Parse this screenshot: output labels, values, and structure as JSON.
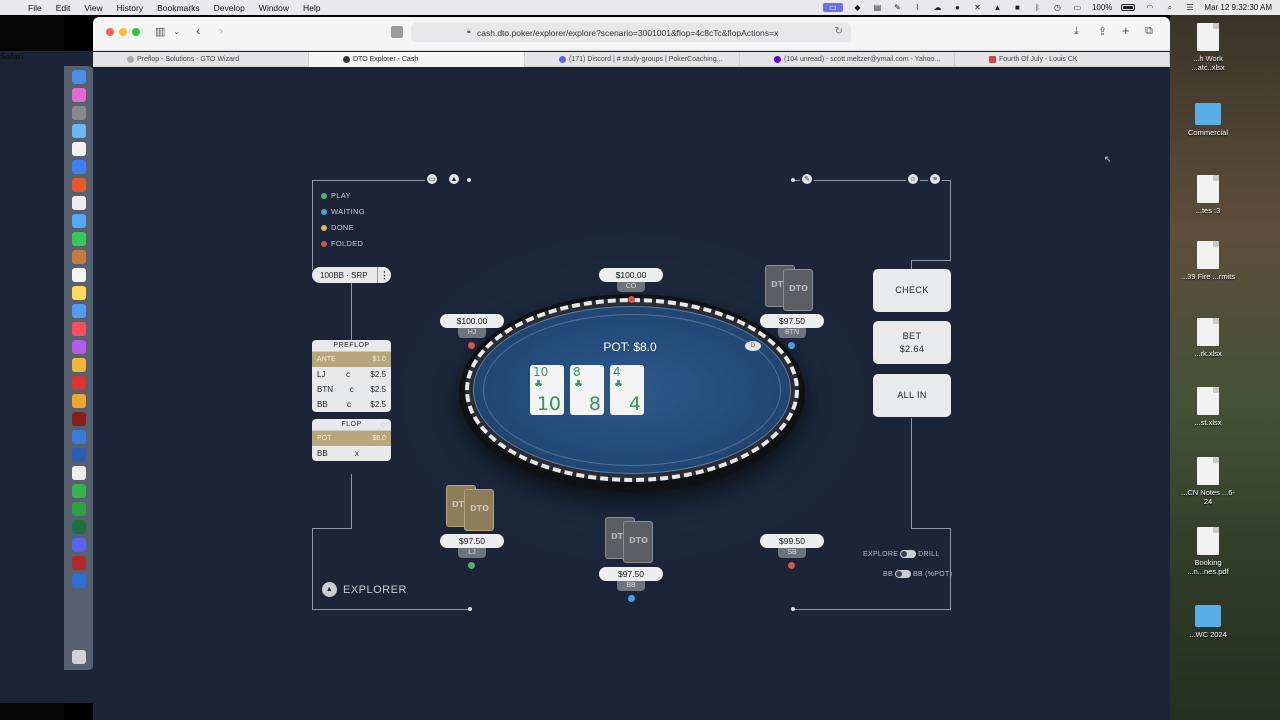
{
  "menubar": {
    "app": "Safari",
    "items": [
      "File",
      "Edit",
      "View",
      "History",
      "Bookmarks",
      "Develop",
      "Window",
      "Help"
    ],
    "battery": "100%",
    "datetime": "Mar 12  9:32:30 AM"
  },
  "browser": {
    "url": "cash.dto.poker/explorer/explore?scenario=3001001&flop=4c8cTc&flopActions=x",
    "tabs": [
      {
        "title": "Preflop - Solutions - GTO Wizard",
        "active": false
      },
      {
        "title": "DTO Explorer - Cash",
        "active": true
      },
      {
        "title": "(171) Discord | # study-groups | PokerCoaching...",
        "active": false
      },
      {
        "title": "(104 unread) - scott.meltzer@ymail.com - Yahoo...",
        "active": false
      },
      {
        "title": "Fourth Of July - Louis CK",
        "active": false
      }
    ]
  },
  "desktop": {
    "items": [
      "...h Work\n...atc..xlsx",
      "Commercial",
      "...tes :3",
      "...39 Fire\n...rmits",
      "...rk.xlsx",
      "...st.xlsx",
      "...CN Notes\n...6-24",
      "Booking\n...n...nes.pdf",
      "...WC 2024"
    ]
  },
  "legend": {
    "items": [
      {
        "label": "PLAY",
        "color": "#4fb06a"
      },
      {
        "label": "WAITING",
        "color": "#4aa3d8"
      },
      {
        "label": "DONE",
        "color": "#e0b94a"
      },
      {
        "label": "FOLDED",
        "color": "#d9534f"
      }
    ]
  },
  "stack_selector": {
    "label": "100BB · SRP",
    "more": "⋮"
  },
  "preflop": {
    "title": "PREFLOP",
    "ante": {
      "label": "ANTE",
      "value": "$1.0"
    },
    "actions": [
      {
        "pos": "LJ",
        "act": "c",
        "amt": "$2.5"
      },
      {
        "pos": "BTN",
        "act": "c",
        "amt": "$2.5"
      },
      {
        "pos": "BB",
        "act": "c",
        "amt": "$2.5"
      }
    ]
  },
  "flop": {
    "title": "FLOP",
    "pot": {
      "label": "POT",
      "value": "$8.0"
    },
    "actions": [
      {
        "pos": "BB",
        "act": "x"
      }
    ]
  },
  "seats": {
    "co": {
      "stack": "$100.00",
      "pos": "CO"
    },
    "hj": {
      "stack": "$100.00",
      "pos": "HJ"
    },
    "btn": {
      "stack": "$97.50",
      "pos": "BTN"
    },
    "lj": {
      "stack": "$97.50",
      "pos": "LJ"
    },
    "bb": {
      "stack": "$97.50",
      "pos": "BB"
    },
    "sb": {
      "stack": "$99.50",
      "pos": "SB"
    }
  },
  "table": {
    "pot": "POT: $8.0",
    "dealer": "D",
    "card_back_text": "DTO",
    "board": [
      {
        "rank": "10",
        "suit": "♣"
      },
      {
        "rank": "8",
        "suit": "♣"
      },
      {
        "rank": "4",
        "suit": "♣"
      }
    ]
  },
  "actions": {
    "check": "CHECK",
    "bet_label": "BET",
    "bet_amount": "$2.64",
    "allin": "ALL IN"
  },
  "explorer": {
    "label": "EXPLORER"
  },
  "toggles": {
    "mode_left": "EXPLORE",
    "mode_right": "DRILL",
    "unit_left": "BB",
    "unit_right": "BB (%POT)"
  },
  "colors": {
    "play": "#4fb06a",
    "waiting": "#4aa3d8",
    "folded": "#d9534f",
    "card_green": "#2e9b5a",
    "felt": "#234a78"
  }
}
